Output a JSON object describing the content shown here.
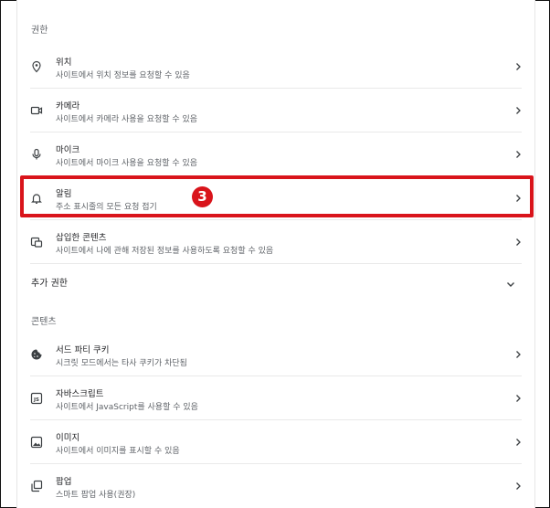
{
  "permissions": {
    "section_title": "권한",
    "items": [
      {
        "title": "위치",
        "subtitle": "사이트에서 위치 정보를 요청할 수 있음",
        "icon": "location-pin-icon"
      },
      {
        "title": "카메라",
        "subtitle": "사이트에서 카메라 사용을 요청할 수 있음",
        "icon": "camera-icon"
      },
      {
        "title": "마이크",
        "subtitle": "사이트에서 마이크 사용을 요청할 수 있음",
        "icon": "microphone-icon"
      },
      {
        "title": "알림",
        "subtitle": "주소 표시줄의 모든 요청 접기",
        "icon": "bell-icon"
      },
      {
        "title": "삽입한 콘텐츠",
        "subtitle": "사이트에서 나에 관해 저장된 정보를 사용하도록 요청할 수 있음",
        "icon": "embedded-content-icon"
      }
    ],
    "more_label": "추가 권한"
  },
  "content": {
    "section_title": "콘텐츠",
    "items": [
      {
        "title": "서드 파티 쿠키",
        "subtitle": "시크릿 모드에서는 타사 쿠키가 차단됨",
        "icon": "cookie-icon"
      },
      {
        "title": "자바스크립트",
        "subtitle": "사이트에서 JavaScript를 사용할 수 있음",
        "icon": "javascript-icon"
      },
      {
        "title": "이미지",
        "subtitle": "사이트에서 이미지를 표시할 수 있음",
        "icon": "image-icon"
      },
      {
        "title": "팝업",
        "subtitle": "스마트 팝업 사용(권장)",
        "icon": "popup-icon"
      }
    ]
  },
  "annotation": {
    "step_number": "3",
    "color": "#d9141b"
  }
}
